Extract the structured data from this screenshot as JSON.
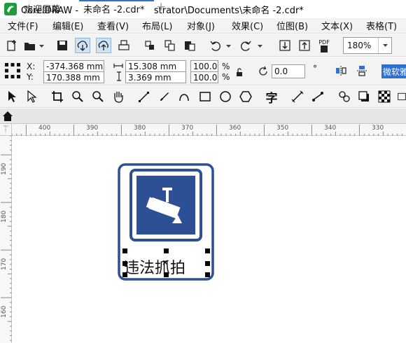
{
  "window": {
    "title": "CorelDRAW - C:\\Users\\Administrator\\Documents\\未命名 -2.cdr*"
  },
  "menu": [
    "文件(F)",
    "编辑(E)",
    "查看(V)",
    "布局(L)",
    "对象(J)",
    "效果(C)",
    "位图(B)",
    "文本(X)",
    "表格(T)"
  ],
  "toolbar": {
    "icons": [
      "new-document-icon",
      "open-folder-icon",
      "save-icon",
      "cloud-download-icon",
      "cloud-upload-icon",
      "print-icon",
      "cut-icon",
      "copy-icon",
      "paste-icon",
      "undo-icon",
      "redo-icon",
      "import-icon",
      "export-icon",
      "pdf-icon"
    ],
    "pdf_label": "PDF",
    "zoom": "180%"
  },
  "property_bar": {
    "x_label": "X:",
    "y_label": "Y:",
    "x_value": "-374.368 mm",
    "y_value": "170.388 mm",
    "width_value": "15.308 mm",
    "height_value": "3.369 mm",
    "scale_x": "100.0",
    "scale_y": "100.0",
    "percent": "%",
    "rotation": "0.0",
    "degree": "°",
    "font": "微软雅黑"
  },
  "tabs": {
    "welcome": "欢迎屏幕",
    "document": "未命名 -2.cdr*",
    "add": "+"
  },
  "rulers": {
    "horizontal": [
      "400",
      "390",
      "380",
      "370",
      "360",
      "350",
      "340",
      "330"
    ],
    "vertical": [
      "190",
      "180",
      "170",
      "160"
    ]
  },
  "sign": {
    "caption": "违法抓拍",
    "frame_color": "#2d4f95",
    "inner_color": "#2d4f95"
  },
  "colors": {
    "accent": "#2f6fd0",
    "toolbar_bg": "#f3f3f3"
  }
}
